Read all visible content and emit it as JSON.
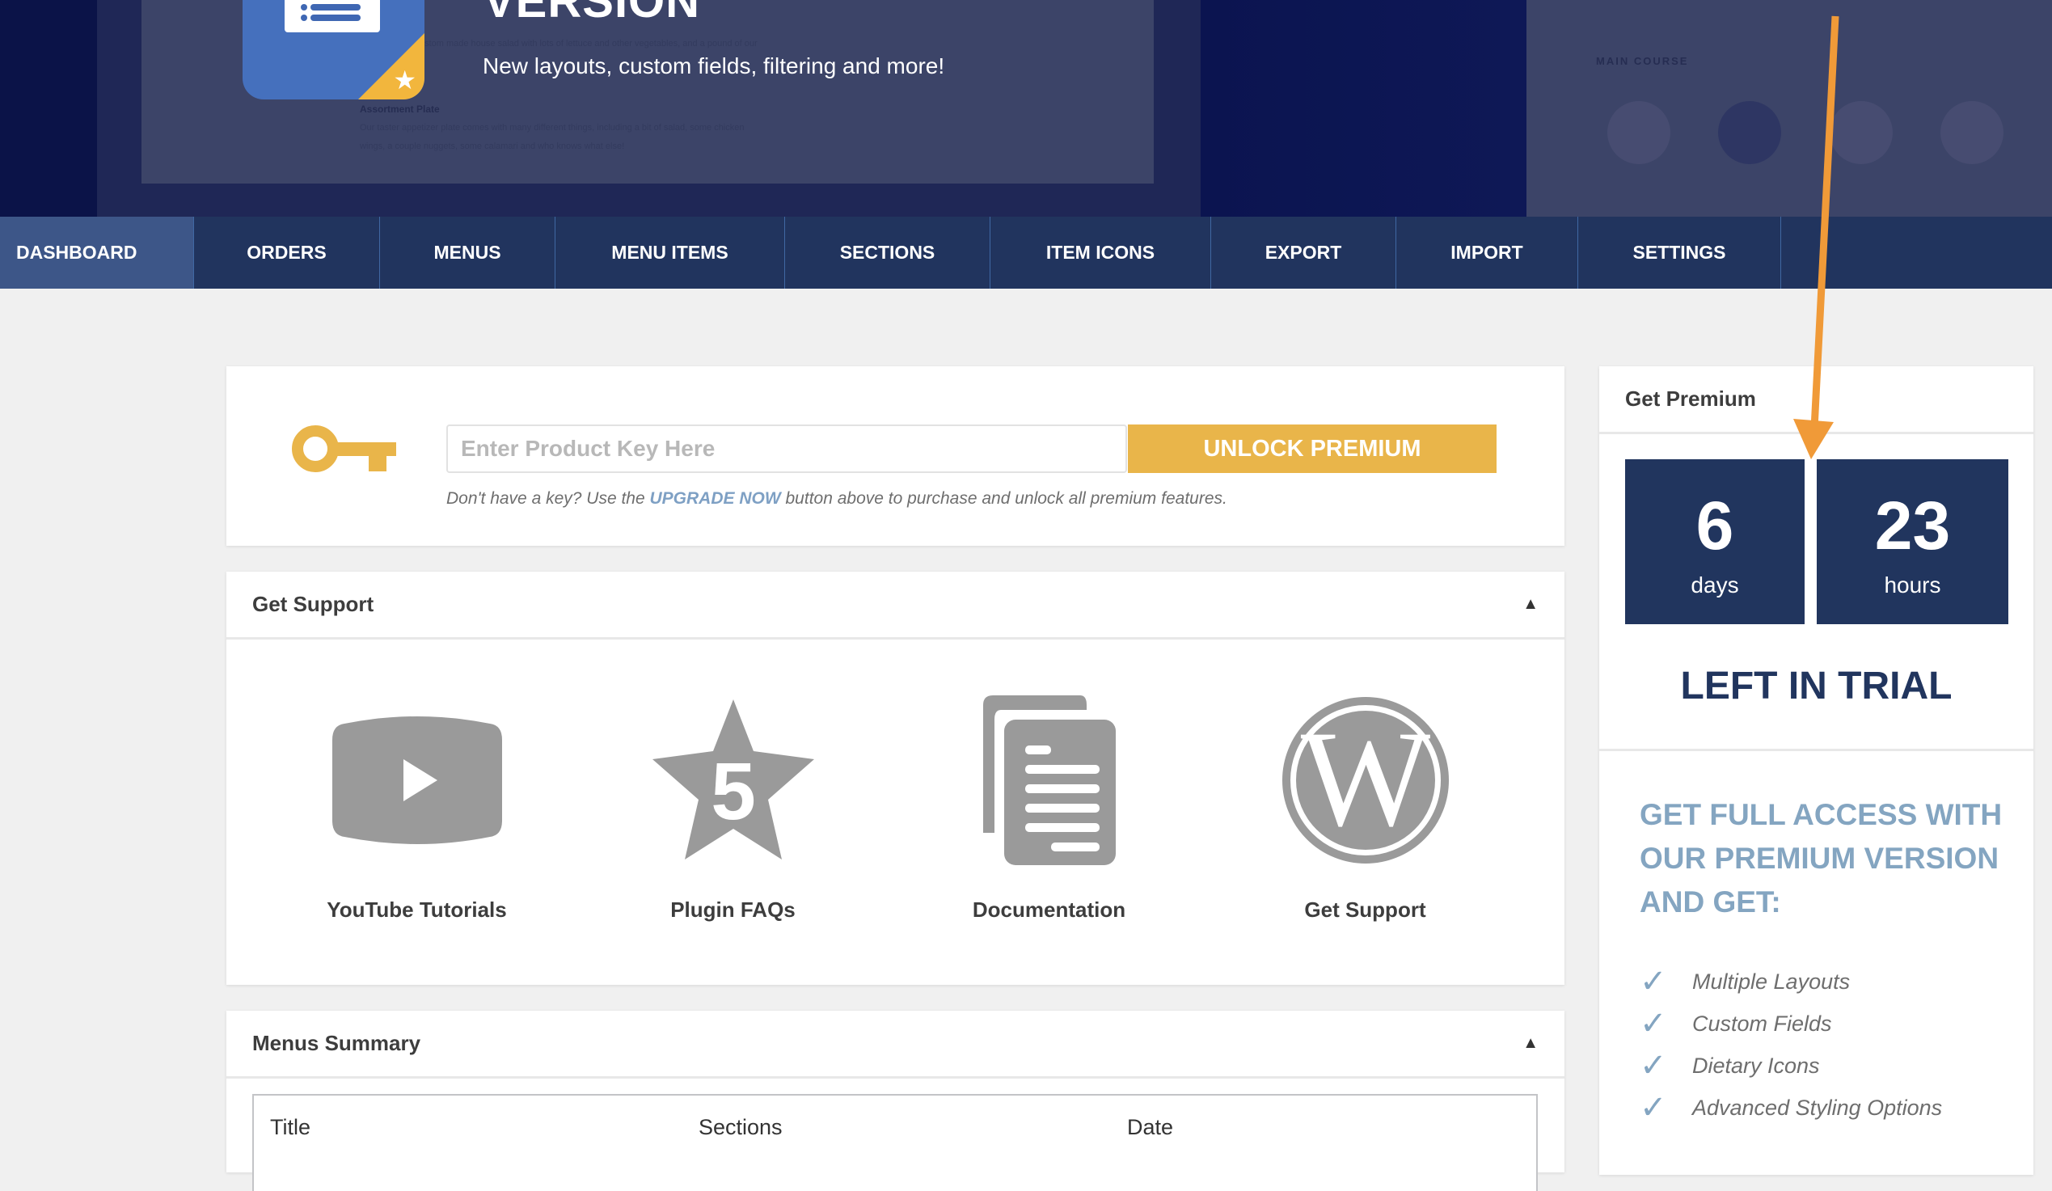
{
  "banner": {
    "title": "VERSION",
    "subtitle": "New layouts, custom fields, filtering and more!",
    "preview_section_title": "MAIN COURSE"
  },
  "nav": {
    "items": [
      {
        "label": "DASHBOARD",
        "active": true
      },
      {
        "label": "ORDERS"
      },
      {
        "label": "MENUS"
      },
      {
        "label": "MENU ITEMS"
      },
      {
        "label": "SECTIONS"
      },
      {
        "label": "ITEM ICONS"
      },
      {
        "label": "EXPORT"
      },
      {
        "label": "IMPORT"
      },
      {
        "label": "SETTINGS"
      }
    ]
  },
  "license": {
    "key_placeholder": "Enter Product Key Here",
    "key_value": "",
    "unlock_label": "UNLOCK PREMIUM",
    "help_prefix": "Don't have a key? Use the ",
    "help_link": "UPGRADE NOW",
    "help_suffix": " button above to purchase and unlock all premium features."
  },
  "support": {
    "title": "Get Support",
    "items": [
      {
        "label": "YouTube Tutorials",
        "icon": "youtube-icon"
      },
      {
        "label": "Plugin FAQs",
        "icon": "star-five-icon",
        "icon_text": "5"
      },
      {
        "label": "Documentation",
        "icon": "documents-icon"
      },
      {
        "label": "Get Support",
        "icon": "wordpress-icon",
        "icon_text": "W"
      }
    ]
  },
  "menus_summary": {
    "title": "Menus Summary",
    "columns": [
      "Title",
      "Sections",
      "Date"
    ]
  },
  "premium": {
    "title": "Get Premium",
    "days": "6",
    "days_label": "days",
    "hours": "23",
    "hours_label": "hours",
    "trial_text": "LEFT IN TRIAL",
    "cta": "GET FULL ACCESS WITH OUR PREMIUM VERSION AND GET:",
    "features": [
      "Multiple Layouts",
      "Custom Fields",
      "Dietary Icons",
      "Advanced Styling Options"
    ]
  },
  "colors": {
    "nav_bg": "#21345e",
    "nav_active": "#3d5688",
    "accent_yellow": "#e9b54a",
    "premium_navy": "#21355e",
    "premium_light": "#84a5c1",
    "annotation_arrow": "#f09a38"
  }
}
